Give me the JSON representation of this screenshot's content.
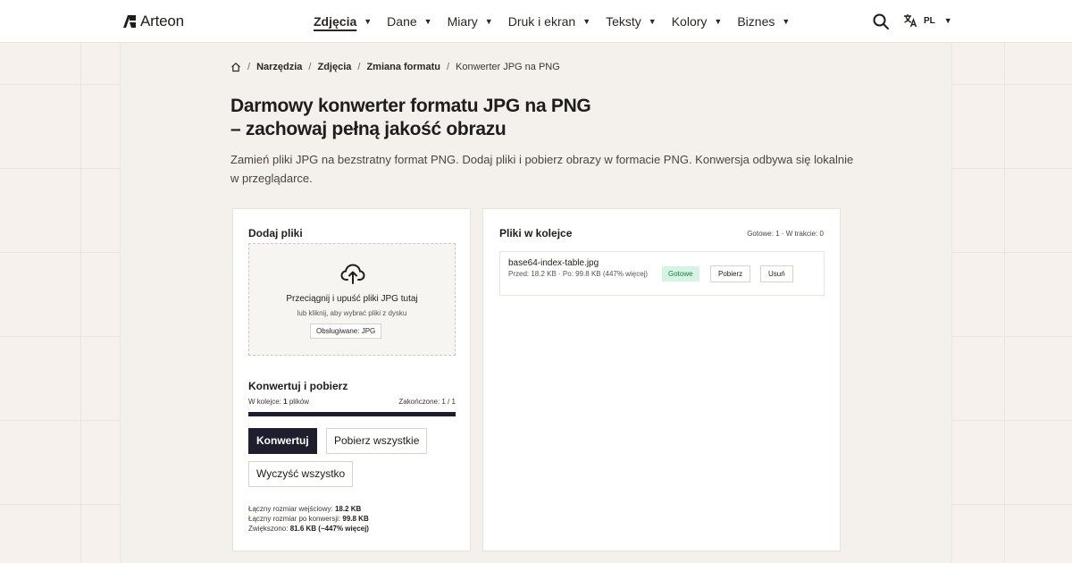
{
  "header": {
    "logo_text": "Arteon",
    "nav": [
      {
        "label": "Zdjęcia",
        "active": true
      },
      {
        "label": "Dane"
      },
      {
        "label": "Miary"
      },
      {
        "label": "Druk i ekran"
      },
      {
        "label": "Teksty"
      },
      {
        "label": "Kolory"
      },
      {
        "label": "Biznes"
      }
    ],
    "caret": "▼",
    "language": "PL"
  },
  "breadcrumb": {
    "items": [
      "Narzędzia",
      "Zdjęcia",
      "Zmiana formatu"
    ],
    "current": "Konwerter JPG na PNG",
    "separator": "/"
  },
  "page": {
    "title": "Darmowy konwerter formatu JPG na PNG – zachowaj pełną jakość obrazu",
    "intro": "Zamień pliki JPG na bezstratny format PNG. Dodaj pliki i pobierz obrazy w formacie PNG. Konwersja odbywa się lokalnie w przeglądarce."
  },
  "upload": {
    "title": "Dodaj pliki",
    "drop_main": "Przeciągnij i upuść pliki JPG tutaj",
    "drop_sub": "lub kliknij, aby wybrać pliki z dysku",
    "supported": "Obsługiwane: JPG"
  },
  "convert": {
    "title": "Konwertuj i pobierz",
    "queue_prefix": "W kolejce:",
    "queue_count": "1",
    "queue_suffix": "plików",
    "done_label": "Zakończone: 1 / 1",
    "progress": 1.0,
    "convert_btn": "Konwertuj",
    "download_all_btn": "Pobierz wszystkie",
    "clear_all_btn": "Wyczyść wszystko",
    "summary": {
      "input_label": "Łączny rozmiar wejściowy:",
      "input_value": "18.2 KB",
      "output_label": "Łączny rozmiar po konwersji:",
      "output_value": "99.8 KB",
      "diff_label": "Zwiększono:",
      "diff_value": "81.6 KB (~447% więcej)"
    }
  },
  "queue": {
    "title": "Pliki w kolejce",
    "status": "Gotowe: 1 · W trakcie: 0",
    "files": [
      {
        "name": "base64-index-table.jpg",
        "meta": "Przed: 18.2 KB · Po: 99.8 KB (447% więcej)",
        "status": "Gotowe",
        "download": "Pobierz",
        "remove": "Usuń"
      }
    ]
  },
  "colors": {
    "accent_dark": "#1e1e2e",
    "success_bg": "#d6f3e3",
    "success_text": "#1b7a47"
  }
}
